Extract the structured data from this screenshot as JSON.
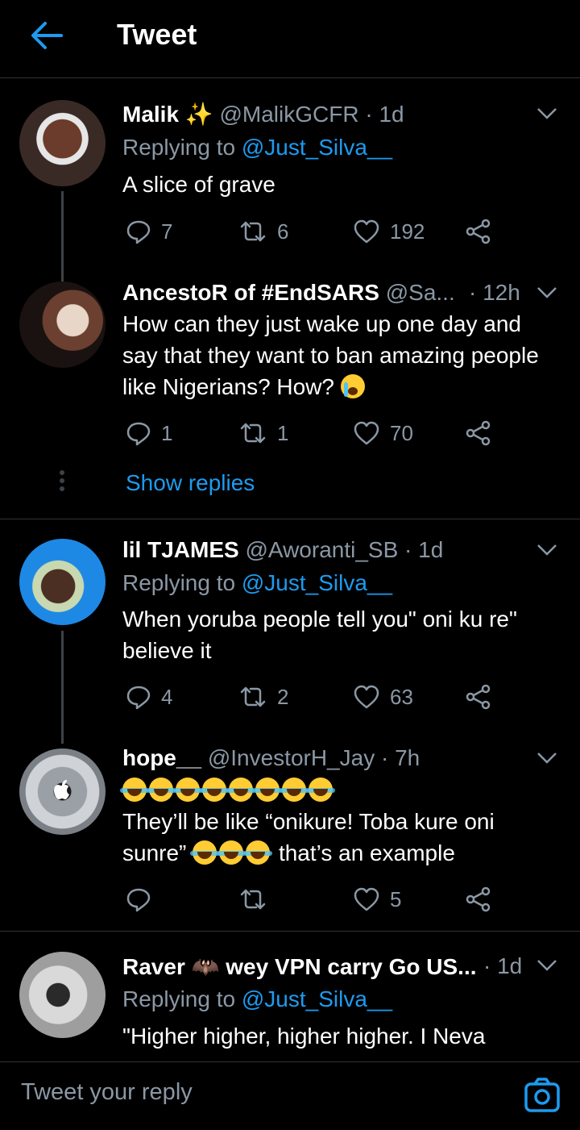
{
  "header": {
    "title": "Tweet",
    "back_icon": "back-arrow-icon",
    "accent": "#1d9bf0"
  },
  "tweets": [
    {
      "name": "Malik",
      "name_suffix_icon": "sparkles-icon",
      "handle": "@MalikGCFR",
      "time": "· 1d",
      "replying_label": "Replying to",
      "replying_to": "@Just_Silva__",
      "text": "A slice of grave",
      "replies": "7",
      "retweets": "6",
      "likes": "192"
    },
    {
      "name": "AncestoR of #EndSARS",
      "handle": "@Sa...",
      "time": "· 12h",
      "text": "How can they just wake up one day and say that they want to ban amazing people like Nigerians? How?",
      "emoji": "loudly-crying-face",
      "replies": "1",
      "retweets": "1",
      "likes": "70"
    },
    {
      "name": "lil TJAMES",
      "handle": "@Aworanti_SB",
      "time": "· 1d",
      "replying_label": "Replying to",
      "replying_to": "@Just_Silva__",
      "text_line1": "When yoruba people tell you\" oni ku re\"",
      "text_line2": "believe it",
      "replies": "4",
      "retweets": "2",
      "likes": "63"
    },
    {
      "name": "hope__",
      "handle": "@InvestorH_Jay",
      "time": "· 7h",
      "emoji_row": "face-with-tears-of-joy x8",
      "text_line1": "They’ll be like “onikure! Toba kure oni",
      "text_line2_a": "sunre”",
      "text_line2_b": "that’s an example",
      "replies": "",
      "retweets": "",
      "likes": "5"
    },
    {
      "name": "Raver",
      "name_suffix_icon": "bat-icon",
      "name_rest": "wey VPN carry Go US...",
      "time": "· 1d",
      "replying_label": "Replying to",
      "replying_to": "@Just_Silva__",
      "text": "\"Higher higher, higher higher. I Neva"
    }
  ],
  "show_replies": "Show replies",
  "reply_bar": {
    "placeholder": "Tweet your reply",
    "camera_icon": "camera-icon"
  }
}
